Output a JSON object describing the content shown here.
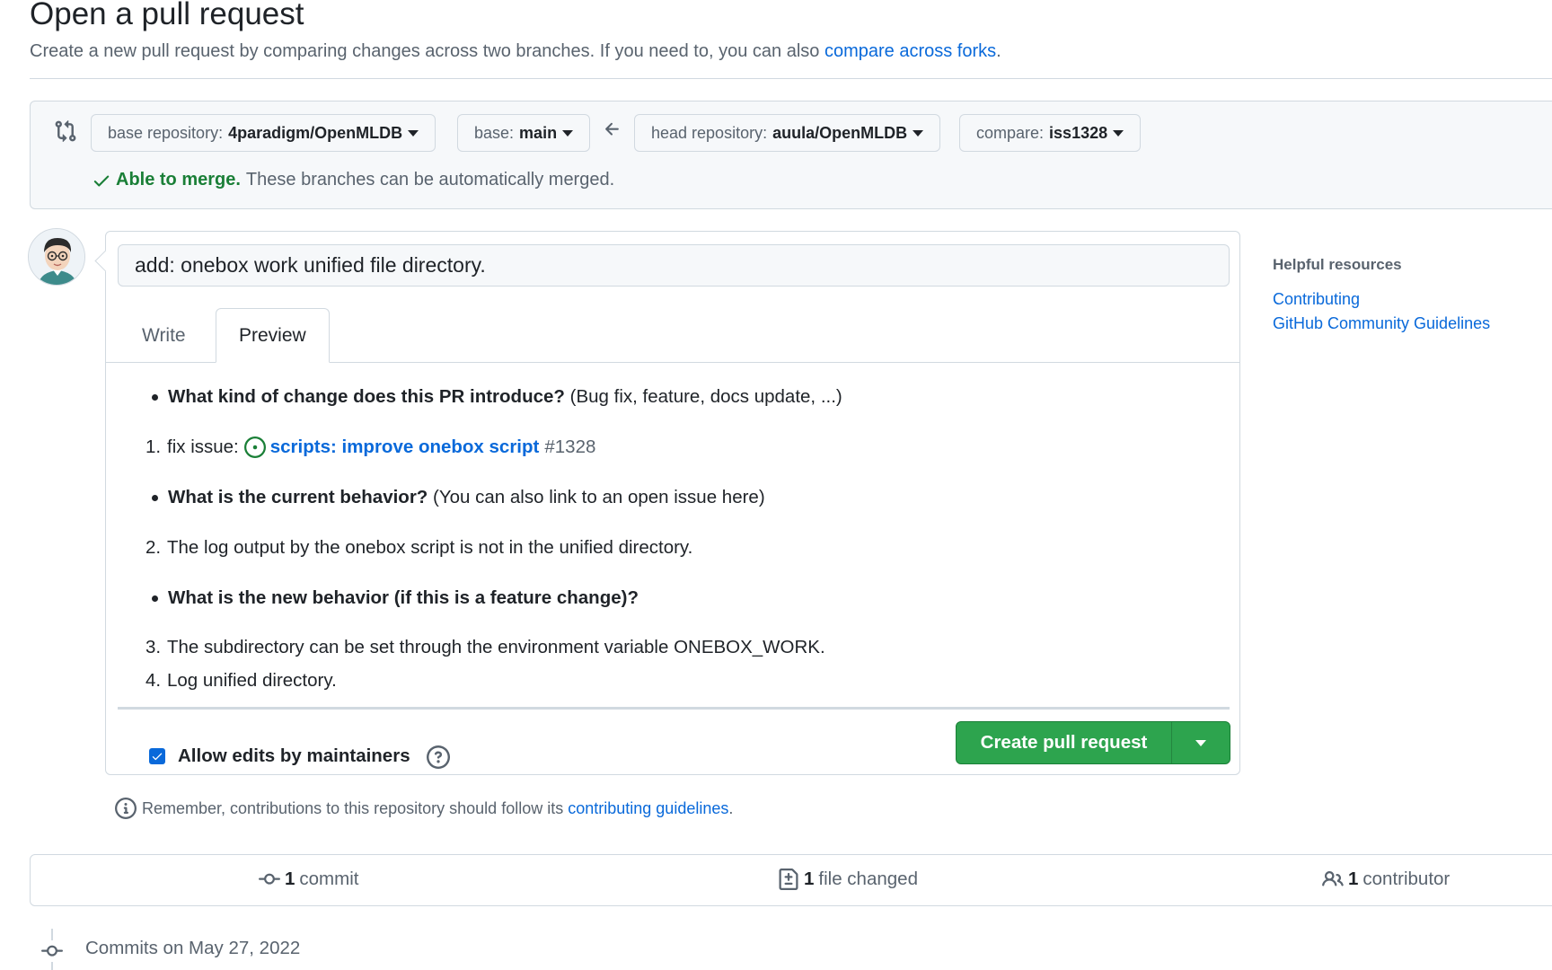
{
  "header": {
    "title": "Open a pull request",
    "description": "Create a new pull request by comparing changes across two branches. If you need to, you can also",
    "compare_forks_link": "compare across forks",
    "period": "."
  },
  "range": {
    "base_repo_label": "base repository:",
    "base_repo_value": "4paradigm/OpenMLDB",
    "base_label": "base:",
    "base_value": "main",
    "head_repo_label": "head repository:",
    "head_repo_value": "auula/OpenMLDB",
    "compare_label": "compare:",
    "compare_value": "iss1328",
    "merge_ok": "Able to merge.",
    "merge_desc": "These branches can be automatically merged."
  },
  "composer": {
    "title_value": "add: onebox work unified file directory.",
    "tabs": [
      {
        "label": "Write"
      },
      {
        "label": "Preview"
      }
    ],
    "preview": {
      "q1_bold": "What kind of change does this PR introduce?",
      "q1_rest": "(Bug fix, feature, docs update, ...)",
      "item1_num": "1.",
      "item1_prefix": "fix issue:",
      "item1_link": "scripts: improve onebox script",
      "item1_issue": "#1328",
      "q2_bold": "What is the current behavior?",
      "q2_rest": "(You can also link to an open issue here)",
      "item2_num": "2.",
      "item2_text": "The log output by the onebox script is not in the unified directory.",
      "q3_bold": "What is the new behavior (if this is a feature change)?",
      "item3_num": "3.",
      "item3_text": "The subdirectory can be set through the environment variable ONEBOX_WORK.",
      "item4_num": "4.",
      "item4_text": "Log unified directory."
    },
    "allow_edits_label": "Allow edits by maintainers",
    "create_button": "Create pull request"
  },
  "note": {
    "text": "Remember, contributions to this repository should follow its",
    "link": "contributing guidelines",
    "period": "."
  },
  "sidebar": {
    "title": "Helpful resources",
    "links": [
      {
        "label": "Contributing"
      },
      {
        "label": "GitHub Community Guidelines"
      }
    ]
  },
  "stats": {
    "commits_count": "1",
    "commits_label": "commit",
    "files_count": "1",
    "files_label": "file changed",
    "contributors_count": "1",
    "contributors_label": "contributor"
  },
  "timeline": {
    "commits_date": "Commits on May 27, 2022"
  },
  "colors": {
    "accent_link": "#0969da",
    "success": "#1a7f37",
    "button_green": "#2da44e",
    "border": "#d1d9e0",
    "muted": "#59636e"
  },
  "icons": [
    "git-compare-icon",
    "arrow-left-icon",
    "check-icon",
    "issue-opened-icon",
    "question-icon",
    "info-icon",
    "commit-icon",
    "file-diff-icon",
    "people-icon",
    "caret-down-icon"
  ]
}
